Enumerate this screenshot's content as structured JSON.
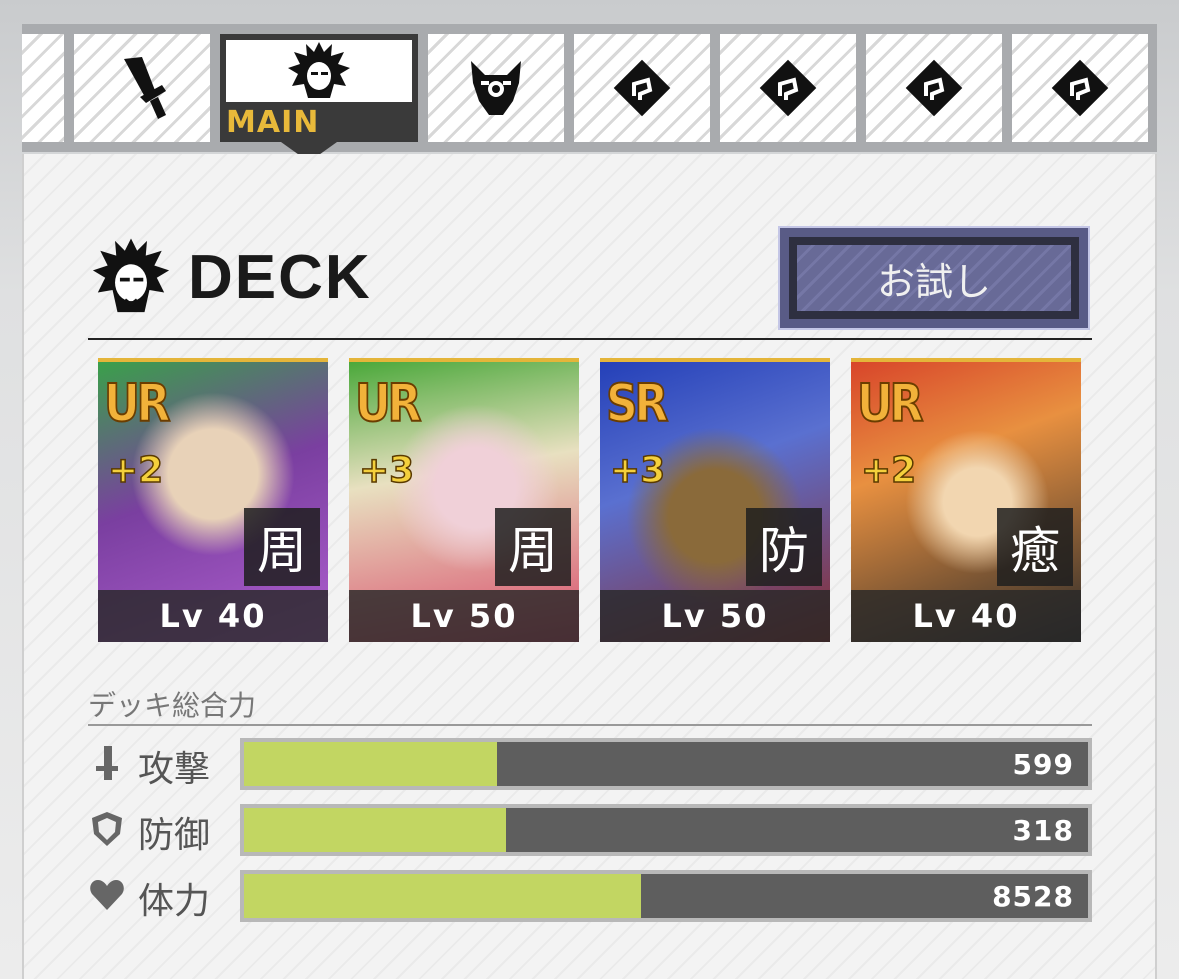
{
  "tabs": {
    "main_label": "MAIN",
    "items": [
      {
        "icon": "partial-tab"
      },
      {
        "icon": "sword-icon"
      },
      {
        "icon": "warrior-head-icon",
        "active": true
      },
      {
        "icon": "demon-mask-icon"
      },
      {
        "icon": "locked-emblem-icon"
      },
      {
        "icon": "locked-emblem-icon"
      },
      {
        "icon": "locked-emblem-icon"
      },
      {
        "icon": "locked-emblem-icon"
      }
    ]
  },
  "deck": {
    "title": "DECK",
    "try_button": "お試し"
  },
  "cards": [
    {
      "rarity": "UR",
      "plus": "+2",
      "role": "周",
      "level": "Lv 40",
      "theme": "#7a3fa0"
    },
    {
      "rarity": "UR",
      "plus": "+3",
      "role": "周",
      "level": "Lv 50",
      "theme": "#4aa83a"
    },
    {
      "rarity": "SR",
      "plus": "+3",
      "role": "防",
      "level": "Lv 50",
      "theme": "#2440b8"
    },
    {
      "rarity": "UR",
      "plus": "+2",
      "role": "癒",
      "level": "Lv 40",
      "theme": "#d8452a"
    }
  ],
  "power": {
    "label": "デッキ総合力",
    "stats": [
      {
        "name": "攻撃",
        "icon": "sword-icon",
        "value": "599",
        "fill_fraction": 0.3
      },
      {
        "name": "防御",
        "icon": "shield-icon",
        "value": "318",
        "fill_fraction": 0.31
      },
      {
        "name": "体力",
        "icon": "heart-icon",
        "value": "8528",
        "fill_fraction": 0.47
      }
    ]
  },
  "colors": {
    "accent_gold": "#e8b93a",
    "bar_fill": "#c2d662",
    "bar_bg": "#5e5e5e",
    "button_bg": "#595b86"
  }
}
